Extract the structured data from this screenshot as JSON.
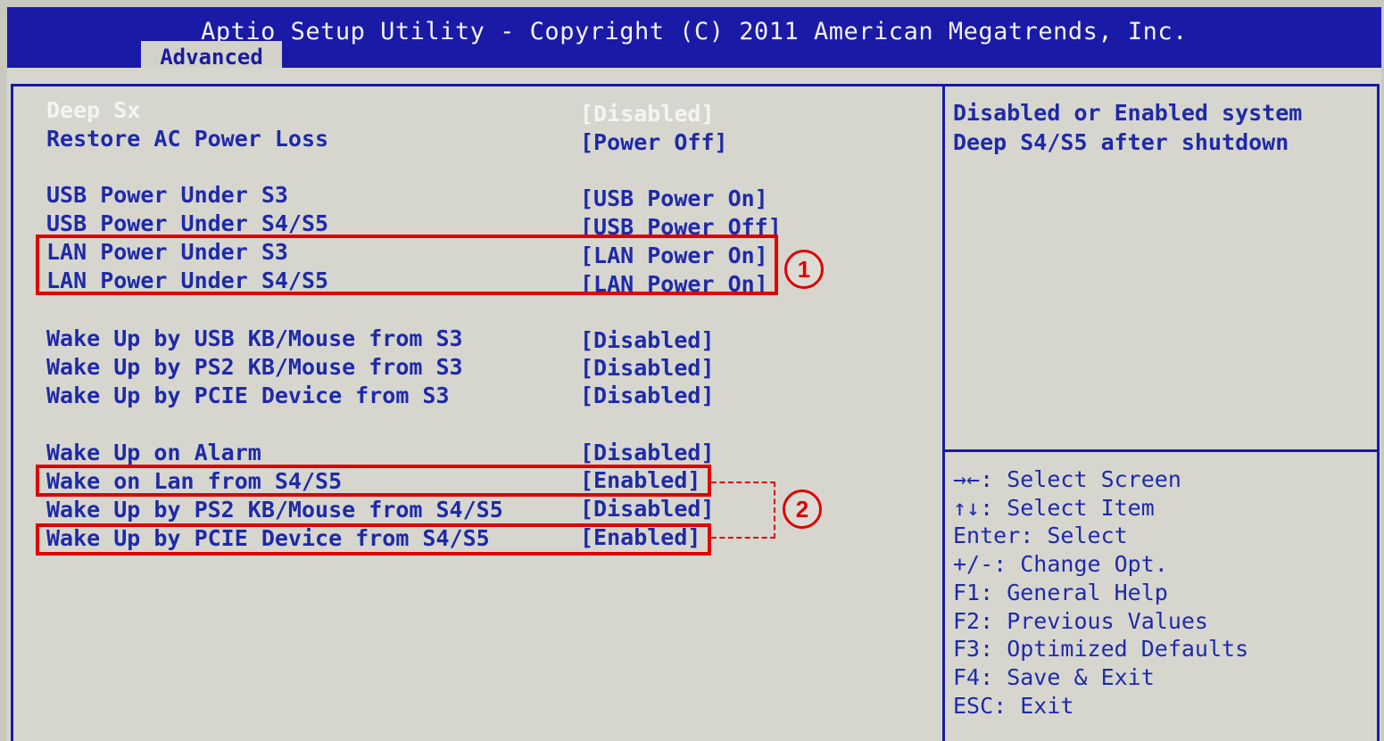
{
  "header": {
    "title": "Aptio Setup Utility - Copyright (C) 2011 American Megatrends, Inc.",
    "tab": "Advanced"
  },
  "settings": [
    {
      "label": "Deep Sx",
      "value": "[Disabled]"
    },
    {
      "label": "Restore AC Power Loss",
      "value": "[Power Off]"
    },
    {
      "label": "USB Power Under S3",
      "value": "[USB Power On]"
    },
    {
      "label": "USB Power Under S4/S5",
      "value": "[USB Power Off]"
    },
    {
      "label": "LAN Power Under S3",
      "value": "[LAN Power On]"
    },
    {
      "label": "LAN Power Under S4/S5",
      "value": "[LAN Power On]"
    },
    {
      "label": "Wake Up by USB KB/Mouse from S3",
      "value": "[Disabled]"
    },
    {
      "label": "Wake Up by PS2 KB/Mouse from S3",
      "value": "[Disabled]"
    },
    {
      "label": "Wake Up by PCIE Device from S3",
      "value": "[Disabled]"
    },
    {
      "label": "Wake Up on Alarm",
      "value": "[Disabled]"
    },
    {
      "label": "Wake on Lan from S4/S5",
      "value": "[Enabled]"
    },
    {
      "label": "Wake Up by PS2 KB/Mouse from S4/S5",
      "value": "[Disabled]"
    },
    {
      "label": "Wake Up by PCIE Device from S4/S5",
      "value": "[Enabled]"
    }
  ],
  "help_text": [
    "Disabled or Enabled system",
    "Deep S4/S5 after shutdown"
  ],
  "key_help": [
    "→←: Select Screen",
    "↑↓: Select Item",
    "Enter: Select",
    "+/-: Change Opt.",
    "F1: General Help",
    "F2: Previous Values",
    "F3: Optimized Defaults",
    "F4: Save & Exit",
    "ESC: Exit"
  ],
  "annotations": {
    "badge_1": "1",
    "badge_2": "2",
    "color": "#e00000"
  },
  "colors": {
    "bios_blue": "#1a1aa6",
    "panel_gray": "#d6d6cf",
    "selected_text": "#f4f4f4"
  }
}
